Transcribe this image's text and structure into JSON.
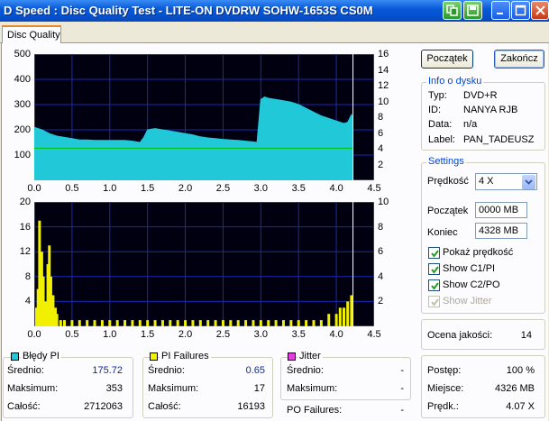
{
  "window": {
    "title": "D Speed : Disc Quality Test  -  LITE-ON DVDRW SOHW-1653S CS0M"
  },
  "tabs": [
    {
      "label": "Disc Quality"
    }
  ],
  "buttons": {
    "start": "Początek",
    "end": "Zakończ"
  },
  "disc_info": {
    "title": "Info o dysku",
    "rows": [
      {
        "label": "Typ:",
        "value": "DVD+R"
      },
      {
        "label": "ID:",
        "value": "NANYA RJB"
      },
      {
        "label": "Data:",
        "value": "n/a"
      },
      {
        "label": "Label:",
        "value": "PAN_TADEUSZ"
      }
    ]
  },
  "settings": {
    "title": "Settings",
    "speed_label": "Prędkość",
    "speed_value": "4 X",
    "start_label": "Początek",
    "start_value": "0000 MB",
    "end_label": "Koniec",
    "end_value": "4328 MB",
    "checkboxes": [
      {
        "label": "Pokaż prędkość",
        "checked": true,
        "enabled": true
      },
      {
        "label": "Show C1/PI",
        "checked": true,
        "enabled": true
      },
      {
        "label": "Show C2/PO",
        "checked": true,
        "enabled": true
      },
      {
        "label": "Show Jitter",
        "checked": true,
        "enabled": false
      }
    ]
  },
  "quality": {
    "label": "Ocena jakości:",
    "value": "14"
  },
  "progress": {
    "rows": [
      {
        "label": "Postęp:",
        "value": "100 %"
      },
      {
        "label": "Miejsce:",
        "value": "4326 MB"
      },
      {
        "label": "Prędk.:",
        "value": "4.07 X"
      }
    ]
  },
  "stats": {
    "pi_errors": {
      "title": "Błędy PI",
      "color": "#20c8d8",
      "rows": [
        {
          "label": "Średnio:",
          "value": "175.72"
        },
        {
          "label": "Maksimum:",
          "value": "353"
        },
        {
          "label": "Całość:",
          "value": "2712063"
        }
      ]
    },
    "pi_failures": {
      "title": "PI Failures",
      "color": "#f0f000",
      "rows": [
        {
          "label": "Średnio:",
          "value": "0.65"
        },
        {
          "label": "Maksimum:",
          "value": "17"
        },
        {
          "label": "Całość:",
          "value": "16193"
        }
      ]
    },
    "jitter": {
      "title": "Jitter",
      "color": "#e040e0",
      "rows": [
        {
          "label": "Średnio:",
          "value": "-"
        },
        {
          "label": "Maksimum:",
          "value": "-"
        }
      ]
    },
    "po_failures": {
      "label": "PO Failures:",
      "value": "-"
    }
  },
  "chart_data": [
    {
      "type": "area",
      "series": [
        {
          "name": "Błędy PI",
          "color": "#20c8d8",
          "x": [
            0.0,
            0.05,
            0.1,
            0.2,
            0.3,
            0.4,
            0.5,
            0.6,
            0.7,
            0.8,
            0.9,
            1.0,
            1.1,
            1.2,
            1.3,
            1.4,
            1.45,
            1.5,
            1.6,
            1.7,
            1.8,
            1.9,
            2.0,
            2.1,
            2.2,
            2.3,
            2.4,
            2.5,
            2.6,
            2.7,
            2.8,
            2.9,
            2.95,
            3.0,
            3.05,
            3.1,
            3.2,
            3.3,
            3.4,
            3.5,
            3.6,
            3.7,
            3.8,
            3.9,
            4.0,
            4.1,
            4.15,
            4.2,
            4.22
          ],
          "y": [
            210,
            205,
            200,
            185,
            175,
            170,
            165,
            160,
            160,
            158,
            158,
            158,
            158,
            158,
            155,
            150,
            170,
            200,
            205,
            200,
            195,
            190,
            185,
            180,
            172,
            168,
            165,
            162,
            160,
            158,
            155,
            152,
            150,
            320,
            330,
            325,
            320,
            315,
            310,
            300,
            285,
            270,
            255,
            245,
            235,
            225,
            230,
            260,
            250
          ]
        },
        {
          "name": "Speed",
          "color": "#00c000",
          "x": [
            0.0,
            4.22
          ],
          "y": [
            4.07,
            4.07
          ]
        }
      ],
      "xlim": [
        0,
        4.5
      ],
      "ylim": [
        0,
        500
      ],
      "y2lim": [
        0,
        16
      ],
      "xticks": [
        "0.0",
        "0.5",
        "1.0",
        "1.5",
        "2.0",
        "2.5",
        "3.0",
        "3.5",
        "4.0",
        "4.5"
      ],
      "yticks": [
        "500",
        "400",
        "300",
        "200",
        "100"
      ],
      "y2ticks": [
        "16",
        "14",
        "12",
        "10",
        "8",
        "6",
        "4",
        "2"
      ],
      "grid": true
    },
    {
      "type": "bar",
      "series": [
        {
          "name": "PI Failures",
          "color": "#f0f000",
          "x": [
            0.03,
            0.05,
            0.07,
            0.1,
            0.12,
            0.15,
            0.18,
            0.2,
            0.22,
            0.25,
            0.28,
            0.3,
            0.35,
            0.4,
            0.5,
            0.6,
            0.7,
            0.8,
            0.9,
            1.0,
            1.1,
            1.2,
            1.3,
            1.4,
            1.5,
            1.6,
            1.7,
            1.8,
            1.9,
            2.0,
            2.1,
            2.2,
            2.3,
            2.4,
            2.5,
            2.6,
            2.7,
            2.8,
            2.9,
            3.0,
            3.1,
            3.2,
            3.3,
            3.4,
            3.5,
            3.6,
            3.7,
            3.8,
            3.9,
            4.0,
            4.05,
            4.1,
            4.15,
            4.2
          ],
          "y": [
            3,
            6,
            17,
            12,
            8,
            4,
            10,
            13,
            8,
            5,
            3,
            2,
            1,
            1,
            1,
            1,
            1,
            1,
            1,
            1,
            1,
            1,
            1,
            1,
            1,
            1,
            1,
            1,
            1,
            1,
            1,
            1,
            1,
            1,
            1,
            1,
            1,
            1,
            1,
            1,
            1,
            1,
            1,
            1,
            1,
            1,
            1,
            1,
            2,
            2,
            3,
            3,
            4,
            5
          ]
        }
      ],
      "xlim": [
        0,
        4.5
      ],
      "ylim": [
        0,
        20
      ],
      "y2lim": [
        0,
        10
      ],
      "xticks": [
        "0.0",
        "0.5",
        "1.0",
        "1.5",
        "2.0",
        "2.5",
        "3.0",
        "3.5",
        "4.0",
        "4.5"
      ],
      "yticks": [
        "20",
        "16",
        "12",
        "8",
        "4"
      ],
      "y2ticks": [
        "10",
        "8",
        "6",
        "4",
        "2"
      ],
      "grid": true
    }
  ]
}
